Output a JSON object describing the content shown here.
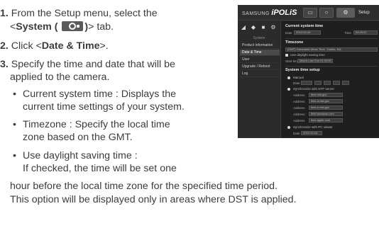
{
  "steps": {
    "s1_num": "1.",
    "s1_a": "From the Setup menu, select the",
    "s1_b_pre": "<",
    "s1_b_bold": "System (",
    "s1_b_bold2": ")",
    "s1_b_post": "> tab.",
    "s2_num": "2.",
    "s2_pre": "Click <",
    "s2_bold": "Date & Time",
    "s2_post": ">.",
    "s3_num": "3.",
    "s3_a": "Specify the time and date that will be",
    "s3_b": "applied to the camera."
  },
  "bullets": {
    "b1_a": "Current system time : Displays the",
    "b1_b": "current time settings of your system.",
    "b2_a": "Timezone : Specify the local time",
    "b2_b": "zone based on the GMT.",
    "b3_a": "Use daylight saving time :",
    "b3_b": "If checked, the time will be set one",
    "b3_c": "hour before the local time zone for the specified time period.",
    "b3_d": "This option will be displayed only in areas where DST is applied."
  },
  "camera_ui": {
    "brand_prefix": "SAMSUNG",
    "brand_name": "iPOLiS",
    "setup_label": "Setup",
    "side_category": "System",
    "side_items": [
      "Product information",
      "Date & Time",
      "User",
      "Upgrade / Reboot",
      "Log"
    ],
    "current_time_title": "Current system time",
    "date_label": "Date",
    "date_value": "2010-02-04",
    "time_label": "Time",
    "time_value": "03:15:22",
    "timezone_title": "Timezone",
    "timezone_value": "(GMT) Greenwich Mean Time : Dublin, Edi",
    "dst_label": "Use daylight saving time",
    "start_label": "Start time",
    "start_value": "March Last Sun 01:00:00",
    "setup_title": "System time setup",
    "manual_label": "Manual",
    "ntp_label": "Synchronize with NTP server",
    "address_label": "Address",
    "ntp_servers": [
      "time.nist.gov",
      "time-a.nist.gov",
      "time-b.nist.gov",
      "time.windows.com",
      "time.apple.com"
    ],
    "pc_label": "Synchronize with PC viewer",
    "pc_date_value": "2010-02-04"
  }
}
